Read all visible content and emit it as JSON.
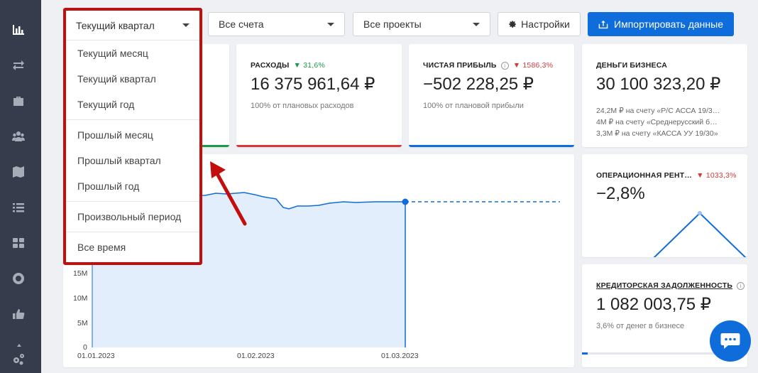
{
  "sidebar": {
    "icons": [
      "bar-chart-icon",
      "transfer-icon",
      "briefcase-icon",
      "users-icon",
      "map-icon",
      "list-icon",
      "grid-icon",
      "lifebuoy-icon",
      "thumbs-up-icon",
      "gears-icon"
    ]
  },
  "filters": {
    "period": "Текущий квартал",
    "accounts": "Все счета",
    "projects": "Все проекты",
    "settings_label": "Настройки",
    "import_label": "Импортировать данные"
  },
  "dropdown": {
    "selected": "Текущий квартал",
    "groups": [
      [
        "Текущий месяц",
        "Текущий квартал",
        "Текущий год"
      ],
      [
        "Прошлый месяц",
        "Прошлый квартал",
        "Прошлый год"
      ],
      [
        "Произвольный период"
      ],
      [
        "Все время"
      ]
    ]
  },
  "cards": {
    "expenses": {
      "label": "РАСХОДЫ",
      "trend": "▼ 31,6%",
      "value": "16 375 961,64 ₽",
      "sub": "100% от плановых расходов",
      "bar_color": "#d33b3b"
    },
    "profit": {
      "label": "ЧИСТАЯ ПРИБЫЛЬ",
      "trend": "▼ 1586,3%",
      "value": "−502 228,25 ₽",
      "sub": "100% от плановой прибыли",
      "bar_color": "#0f6ddb"
    },
    "business_money": {
      "label": "ДЕНЬГИ БИЗНЕСА",
      "value": "30 100 323,20 ₽",
      "lines": [
        "24,2М ₽ на счету «Р/С АССА 19/3…",
        "4М ₽ на счету «Среднерусский б…",
        "3,3М ₽ на счету «КАССА УУ 19/30»"
      ]
    },
    "op_profit": {
      "label": "ОПЕРАЦИОННАЯ РЕНТ…",
      "trend": "▼ 1033,3%",
      "value": "−2,8%"
    },
    "creditor": {
      "label": "КРЕДИТОРСКАЯ ЗАДОЛЖЕННОСТЬ",
      "value": "1 082 003,75 ₽",
      "sub": "3,6% от денег в бизнесе"
    }
  },
  "chart": {
    "y_ticks": [
      "15M",
      "10M",
      "5M",
      "0"
    ],
    "x_ticks": [
      "01.01.2023",
      "01.02.2023",
      "01.03.2023"
    ]
  },
  "colors": {
    "accent": "#0f6ddb",
    "highlight": "#c40d0d",
    "sidebar": "#363c4c"
  }
}
